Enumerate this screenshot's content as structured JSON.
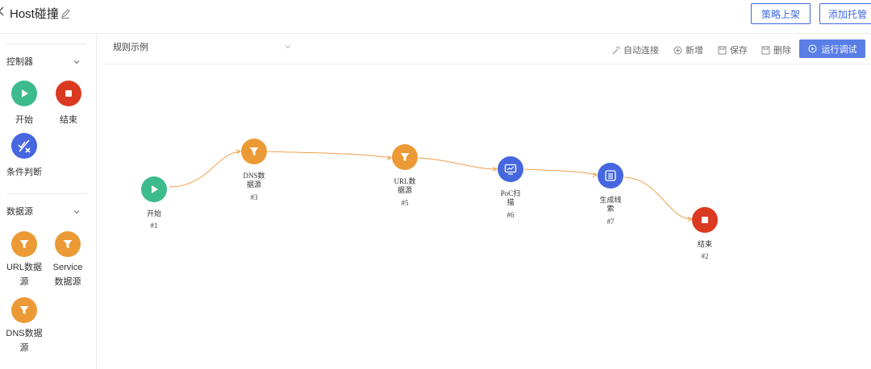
{
  "header": {
    "title": "Host碰撞",
    "publish_label": "策略上架",
    "hosting_label": "添加托管"
  },
  "sidebar": {
    "sections": [
      {
        "title": "控制器",
        "tools": [
          {
            "label": "开始",
            "icon": "play-icon",
            "color": "#3dbb8c"
          },
          {
            "label": "结束",
            "icon": "stop-icon",
            "color": "#db3a22"
          },
          {
            "label": "条件判断",
            "icon": "condition-icon",
            "color": "#4667e0"
          }
        ]
      },
      {
        "title": "数据源",
        "tools": [
          {
            "label": "URL数据\n源",
            "icon": "funnel-icon",
            "color": "#ec9a35"
          },
          {
            "label": "Service\n数据源",
            "icon": "funnel-icon",
            "color": "#ec9a35"
          },
          {
            "label": "DNS数据\n源",
            "icon": "funnel-icon",
            "color": "#ec9a35"
          }
        ]
      }
    ]
  },
  "toolbar": {
    "rule_select": "规则示例",
    "auto_connect": "自动连接",
    "add": "新增",
    "save": "保存",
    "delete": "删除",
    "run": "运行调试"
  },
  "flow": {
    "nodes": [
      {
        "label": "开始",
        "id": "#1",
        "icon": "play-icon",
        "color": "#3dbb8c"
      },
      {
        "label": "DNS数\n据源",
        "id": "#3",
        "icon": "funnel-icon",
        "color": "#ec9a35"
      },
      {
        "label": "URL数\n据源",
        "id": "#5",
        "icon": "funnel-icon",
        "color": "#ec9a35"
      },
      {
        "label": "PoC扫\n描",
        "id": "#6",
        "icon": "monitor-icon",
        "color": "#4667e0"
      },
      {
        "label": "生成线\n索",
        "id": "#7",
        "icon": "list-icon",
        "color": "#4667e0"
      },
      {
        "label": "结束",
        "id": "#2",
        "icon": "stop-icon",
        "color": "#db3a22"
      }
    ],
    "edge_color": "#f0a04b"
  }
}
